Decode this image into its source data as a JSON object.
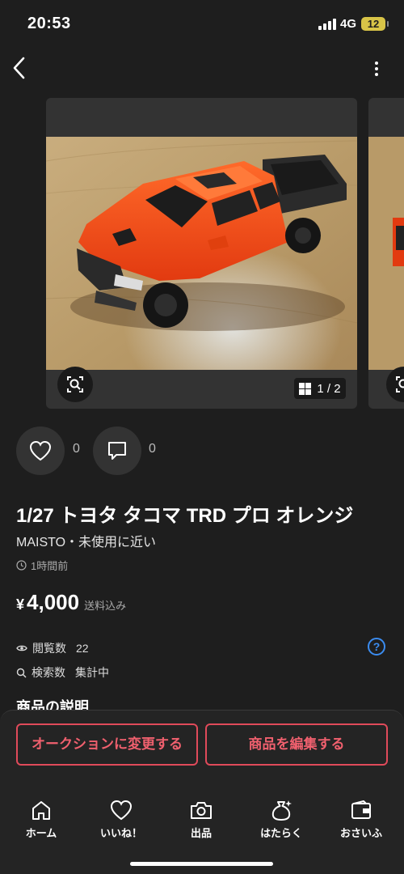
{
  "status_bar": {
    "time": "20:53",
    "network": "4G",
    "battery": "12"
  },
  "gallery": {
    "page_indicator": "1 / 2"
  },
  "reactions": {
    "likes": "0",
    "comments": "0"
  },
  "item": {
    "title": "1/27 トヨタ タコマ TRD プロ オレンジ",
    "subtitle": "MAISTO・未使用に近い",
    "posted": "1時間前",
    "price_symbol": "¥",
    "price": "4,000",
    "shipping": "送料込み"
  },
  "stats": {
    "views_label": "閲覧数",
    "views_value": "22",
    "search_label": "検索数",
    "search_value": "集計中",
    "help": "?"
  },
  "description_heading": "商品の説明",
  "actions": {
    "auction": "オークションに変更する",
    "edit": "商品を編集する"
  },
  "tabs": [
    {
      "label": "ホーム",
      "icon": "home-icon"
    },
    {
      "label": "いいね！",
      "icon": "heart-icon"
    },
    {
      "label": "出品",
      "icon": "camera-icon"
    },
    {
      "label": "はたらく",
      "icon": "money-bag-icon"
    },
    {
      "label": "おさいふ",
      "icon": "wallet-icon"
    }
  ],
  "colors": {
    "accent": "#e04a5a",
    "link": "#3b8cf0",
    "background": "#1e1e1e",
    "product": "#f04a1a"
  }
}
